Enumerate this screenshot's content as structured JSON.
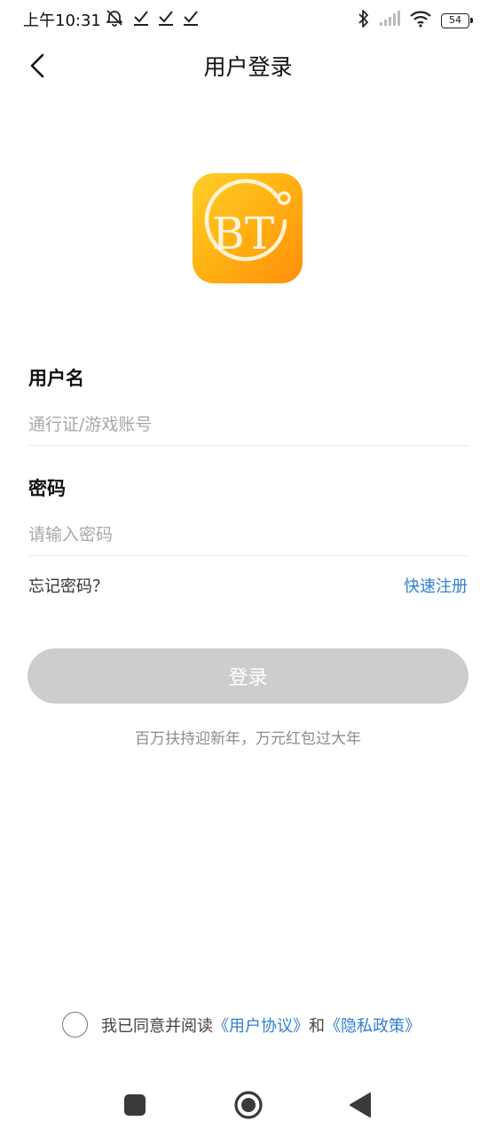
{
  "status_bar": {
    "time": "上午10:31",
    "battery": "54",
    "icons": [
      "alarm-off-icon",
      "check-icon",
      "check-icon",
      "check-icon",
      "bluetooth-icon",
      "signal-icon",
      "wifi-icon",
      "battery-icon"
    ]
  },
  "header": {
    "title": "用户登录",
    "back_icon": "chevron-left-icon"
  },
  "logo": {
    "text": "BT",
    "colors": {
      "top": "#ffcf2a",
      "bottom": "#ff8e0a"
    }
  },
  "form": {
    "username_label": "用户名",
    "username_placeholder": "通行证/游戏账号",
    "username_value": "",
    "password_label": "密码",
    "password_placeholder": "请输入密码",
    "password_value": "",
    "forgot_password": "忘记密码？",
    "quick_register": "快速注册",
    "login_button": "登录"
  },
  "promo_text": "百万扶持迎新年，万元红包过大年",
  "agreement": {
    "checked": false,
    "prefix": "我已同意并阅读",
    "user_agreement": "《用户协议》",
    "and": "和",
    "privacy_policy": "《隐私政策》"
  },
  "colors": {
    "accent_link": "#2f7fd0",
    "button_disabled": "#cdcdcd",
    "placeholder": "#a8a8a8"
  },
  "nav_bar": {
    "icons": [
      "recent-apps-icon",
      "home-icon",
      "back-icon"
    ]
  }
}
